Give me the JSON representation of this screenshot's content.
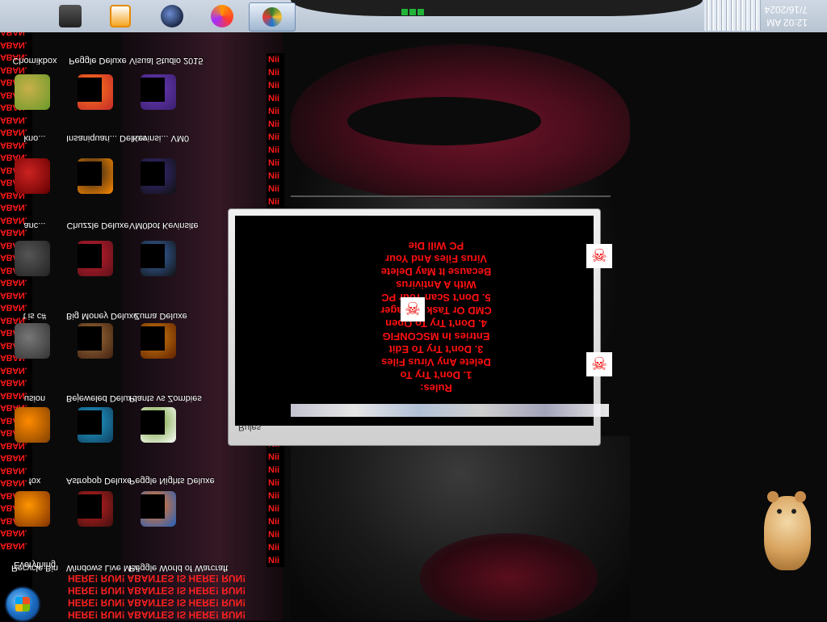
{
  "taskbar": {
    "buttons": [
      {
        "name": "printer-icon"
      },
      {
        "name": "media-player-icon"
      },
      {
        "name": "dark-orb-icon"
      },
      {
        "name": "firefox-icon"
      },
      {
        "name": "program-icon",
        "active": true
      }
    ],
    "clock_time": "12:02 AM",
    "clock_date": "7/16/2024"
  },
  "left_strip_lines": [
    "ABANTES IS HERE! RUN!",
    "ABANTES IS HERE! RUN!",
    "ABAN",
    "ABAN.",
    "ABAN.",
    "ABAN.",
    "ABAN.",
    "ABAN.",
    "ABAN.",
    "ABAN.",
    "ABAN.",
    "ABAN.",
    "ABAN.",
    "ABAN.",
    "ABAN.",
    "ABAN.",
    "ABAN.",
    "ABAN.",
    "ABAN.",
    "ABAN.",
    "ABAN.",
    "ABAN.",
    "ABAN.",
    "ABAN.",
    "ABAN.",
    "ABAN.",
    "ABAN.",
    "ABAN.",
    "ABAN.",
    "ABAN.",
    "ABAN.",
    "ABAN.",
    "ABAN.",
    "ABAN.",
    "ABAN.",
    "ABAN.",
    "ABAN.",
    "ABAN.",
    "ABAN.",
    "ABAN.",
    "ABAN.",
    "ABAN.",
    "ABAN.",
    "ABAN."
  ],
  "nii_label": "Nii",
  "desktop_icons": [
    {
      "label": "Chomikbox"
    },
    {
      "label": "Peggle Deluxe"
    },
    {
      "label": "Visual Studio 2015"
    },
    {
      "label": "kno..."
    },
    {
      "label": "Insaniquari... Deluxe"
    },
    {
      "label": "Kevinsi... VM0"
    },
    {
      "label": "anc..."
    },
    {
      "label": "Chuzzle Deluxe"
    },
    {
      "label": "VM0bot Kevinsite"
    },
    {
      "label": "t is c#"
    },
    {
      "label": "Big Money Deluxe"
    },
    {
      "label": "Zuma Deluxe"
    },
    {
      "label": "usion"
    },
    {
      "label": "Bejeweled Deluxe"
    },
    {
      "label": "Plants vs Zombies"
    },
    {
      "label": "fox"
    },
    {
      "label": "Astropop Deluxe"
    },
    {
      "label": "Peggle Nights Deluxe"
    },
    {
      "label": "Recycle Bin"
    },
    {
      "label": "Windows Live Mail"
    },
    {
      "label": "Peggle World of Warcraft"
    },
    {
      "label": "Everything"
    }
  ],
  "bottom_lines": [
    "HERE! RUN!   ABANTES IS HERE! RUN!",
    "HERE! RUN!   ABANTES IS HERE! RUN!",
    "HERE! RUN!   ABANTES IS HERE! RUN!",
    "HERE! RUN!   ABANTES IS HERE! RUN!"
  ],
  "dialog": {
    "title": "Rules",
    "rules_lines": [
      "Rules:",
      "1. Don't Try To",
      "Delete Any Virus Files",
      "3. Don't Try To Edit",
      "Entries In MSCONFIG",
      "4. Don't Try To Open",
      "CMD Or Task Manager",
      "5. Don't Scan Your PC",
      "With A Antivirus",
      "Because It May Delete",
      "Virus Files And Your",
      "PC Will Die"
    ]
  }
}
